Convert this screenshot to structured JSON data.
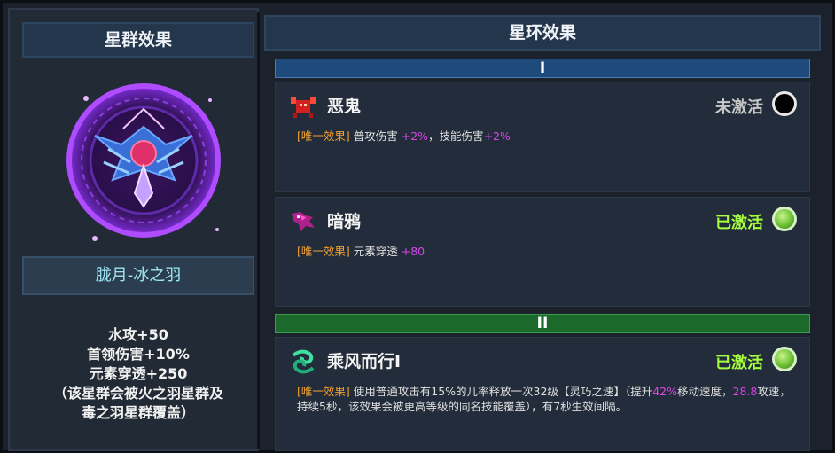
{
  "constellation_panel": {
    "header": "星群效果",
    "name": "胧月-冰之羽",
    "stats": [
      "水攻+50",
      "首领伤害+10%",
      "元素穿透+250",
      "（该星群会被火之羽星群及",
      "毒之羽星群覆盖）"
    ]
  },
  "ring_panel": {
    "header": "星环效果",
    "tiers": [
      "I",
      "II"
    ],
    "entries": [
      {
        "icon": "demon-crab-icon",
        "title": "恶鬼",
        "status": "未激活",
        "active": false,
        "tag": "[唯一效果]",
        "parts": [
          "普攻伤害 ",
          "+2%",
          "，技能伤害",
          "+2%"
        ]
      },
      {
        "icon": "dark-crow-icon",
        "title": "暗鸦",
        "status": "已激活",
        "active": true,
        "tag": "[唯一效果]",
        "parts": [
          "元素穿透 ",
          "+80"
        ]
      },
      {
        "icon": "wind-swirl-icon",
        "title": "乘风而行Ⅰ",
        "status": "已激活",
        "active": true,
        "tag": "[唯一效果]",
        "parts": [
          "使用普通攻击有15%的几率释放一次32级【灵巧之速】（提升",
          "42%",
          "移动速度，",
          "28.8",
          "攻速，持续5秒，该效果会被更高等级的同名技能覆盖），有7秒生效间隔。"
        ]
      }
    ]
  },
  "colors": {
    "active": "#a6ff3f",
    "inactive": "#c8c8c8",
    "tag": "#f0a030",
    "highlight": "#d946e8"
  }
}
